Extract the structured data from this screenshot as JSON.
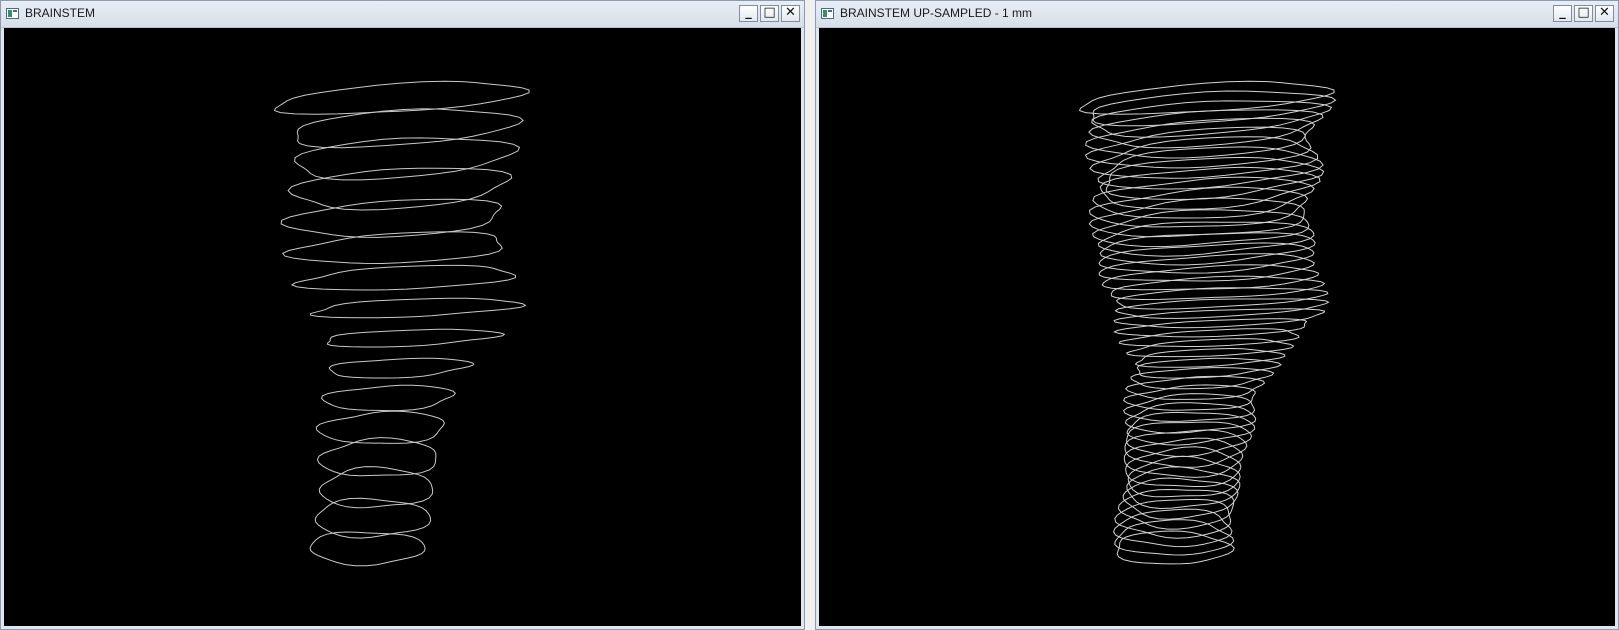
{
  "windows": [
    {
      "title": "BRAINSTEM",
      "controls": {
        "minimize": "_",
        "maximize": "□",
        "close": "✕"
      },
      "contour_color": "#c8c8c8",
      "contour_count": 16
    },
    {
      "title": "BRAINSTEM UP-SAMPLED - 1 mm",
      "controls": {
        "minimize": "_",
        "maximize": "□",
        "close": "✕"
      },
      "contour_color": "#d2d2d2",
      "contour_count": 46
    }
  ]
}
